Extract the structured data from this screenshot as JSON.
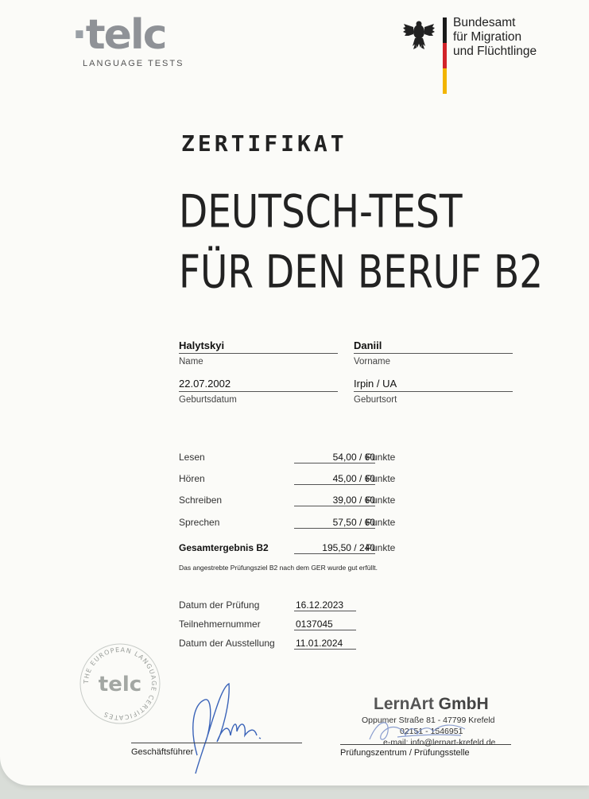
{
  "header": {
    "telc_logo": "telc",
    "telc_subtitle": "LANGUAGE TESTS",
    "bamf_lines": [
      "Bundesamt",
      "für Migration",
      "und Flüchtlinge"
    ]
  },
  "document": {
    "kind": "ZERTIFIKAT",
    "title_line1": "DEUTSCH-TEST",
    "title_line2": "FÜR DEN BERUF B2"
  },
  "person": {
    "name": {
      "value": "Halytskyi",
      "label": "Name"
    },
    "vorname": {
      "value": "Daniil",
      "label": "Vorname"
    },
    "geburtsdatum": {
      "value": "22.07.2002",
      "label": "Geburtsdatum"
    },
    "geburtsort": {
      "value": "Irpin / UA",
      "label": "Geburtsort"
    }
  },
  "scores": [
    {
      "label": "Lesen",
      "value": "54,00 / 60",
      "unit": "Punkte"
    },
    {
      "label": "Hören",
      "value": "45,00 / 60",
      "unit": "Punkte"
    },
    {
      "label": "Schreiben",
      "value": "39,00 / 60",
      "unit": "Punkte"
    },
    {
      "label": "Sprechen",
      "value": "57,50 / 60",
      "unit": "Punkte"
    }
  ],
  "total": {
    "label": "Gesamtergebnis B2",
    "value": "195,50 / 240",
    "unit": "Punkte"
  },
  "result_note": "Das angestrebte Prüfungsziel B2 nach dem GER wurde gut erfüllt.",
  "dates": [
    {
      "label": "Datum der Prüfung",
      "value": "16.12.2023"
    },
    {
      "label": "Teilnehmernummer",
      "value": "0137045"
    },
    {
      "label": "Datum der Ausstellung",
      "value": "11.01.2024"
    }
  ],
  "seal": {
    "ring_text": "THE EUROPEAN LANGUAGE CERTIFICATES",
    "center": "telc"
  },
  "signatures": {
    "left_label": "Geschäftsführer",
    "right_label": "Prüfungszentrum / Prüfungsstelle"
  },
  "stamp": {
    "company_part1": "LernArt",
    "company_part2": " GmbH",
    "address": "Oppumer Straße 81 - 47799 Krefeld",
    "phone": "02151 - 1546951",
    "email": "e-mail: info@lernart-krefeld.de"
  },
  "colors": {
    "flag_black": "#1a1a1a",
    "flag_red": "#d2232a",
    "flag_gold": "#f2b500",
    "signature_blue": "#3a63b8"
  }
}
